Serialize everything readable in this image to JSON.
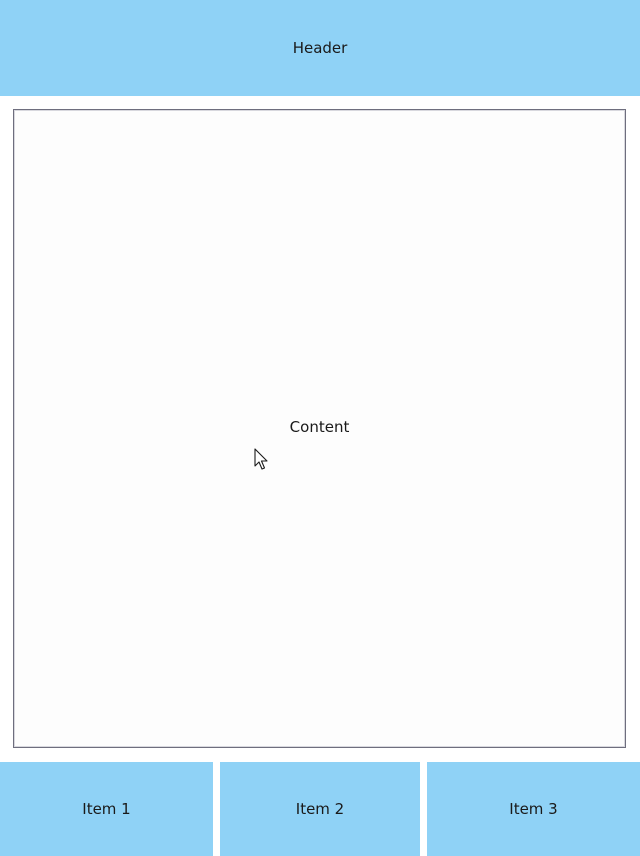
{
  "header": {
    "title": "Header"
  },
  "content": {
    "label": "Content"
  },
  "tabs": [
    {
      "label": "Item 1"
    },
    {
      "label": "Item 2"
    },
    {
      "label": "Item 3"
    }
  ],
  "colors": {
    "bar_background": "#8fd2f6",
    "content_border": "#6e6e7e",
    "page_background": "#ffffff"
  },
  "icons": {
    "pointer": "mouse-pointer-icon"
  }
}
